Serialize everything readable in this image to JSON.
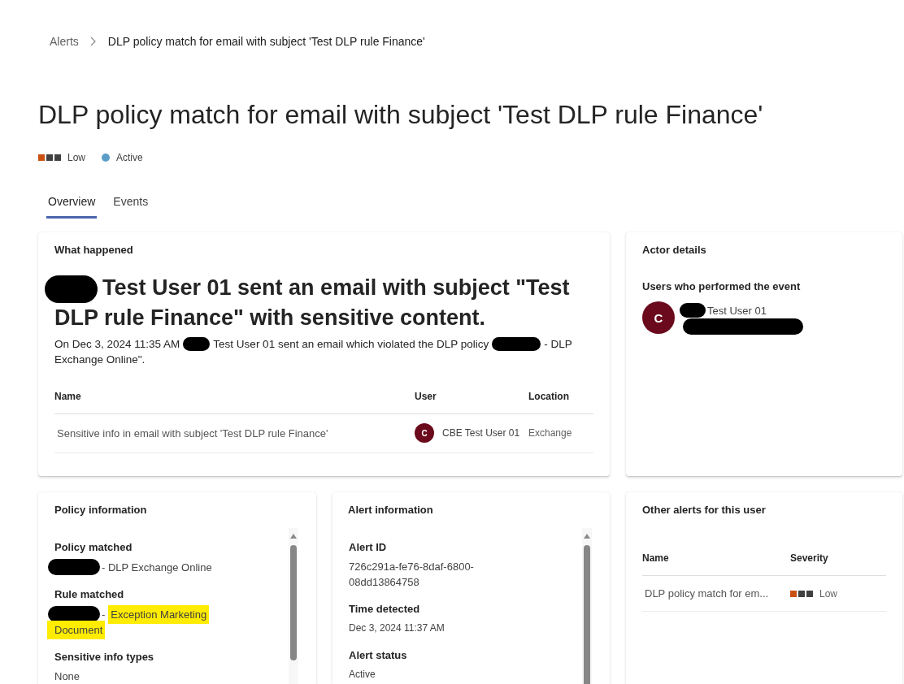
{
  "breadcrumb": [
    {
      "label": "Alerts",
      "current": false
    },
    {
      "label": "DLP policy match for email with subject 'Test DLP rule Finance'",
      "current": true
    }
  ],
  "title": "DLP policy match for email with subject 'Test DLP rule Finance'",
  "severity": {
    "label": "Low",
    "level": 0.33
  },
  "status": {
    "label": "Active",
    "color": "#5b9dc6"
  },
  "tabs": [
    {
      "label": "Overview",
      "selected": true
    },
    {
      "label": "Events",
      "selected": false
    }
  ],
  "what_happened": {
    "heading": "What happened",
    "summary_lines": [
      [
        {
          "kind": "redaction"
        },
        {
          "kind": "text",
          "text": "Test User 01 sent an email with subject \"Test"
        }
      ],
      [
        {
          "kind": "text",
          "text": "DLP rule Finance\" with sensitive content."
        }
      ]
    ],
    "description_lines": [
      [
        {
          "kind": "text",
          "text": "On Dec 3, 2024 11:35 AM"
        },
        {
          "kind": "redaction"
        },
        {
          "kind": "text",
          "text": "Test User 01 sent an email which violated the DLP policy"
        },
        {
          "kind": "redaction"
        },
        {
          "kind": "text",
          "text": "- DLP"
        }
      ],
      [
        {
          "kind": "text",
          "text": "Exchange Online\"."
        }
      ]
    ],
    "table": {
      "columns": [
        "Name",
        "User",
        "Location"
      ],
      "rows": [
        {
          "name": "Sensitive info in email with subject 'Test DLP rule Finance'",
          "user": {
            "initial": "C",
            "name": "CBE Test User 01"
          },
          "location": "Exchange"
        }
      ]
    }
  },
  "actor_details": {
    "heading": "Actor details",
    "subheading": "Users who performed the event",
    "users": [
      {
        "initial": "C",
        "lines": [
          [
            {
              "kind": "redaction"
            },
            {
              "kind": "text",
              "text": "Test User 01"
            }
          ],
          [
            {
              "kind": "redaction"
            }
          ]
        ]
      }
    ]
  },
  "policy_information": {
    "heading": "Policy information",
    "fields": [
      {
        "label": "Policy matched",
        "value_lines": [
          [
            {
              "kind": "redaction"
            },
            {
              "kind": "text",
              "text": "- DLP Exchange Online"
            }
          ]
        ]
      },
      {
        "label": "Rule matched",
        "value_lines": [
          [
            {
              "kind": "redaction"
            },
            {
              "kind": "text",
              "text": "-"
            },
            {
              "kind": "highlight",
              "text": "Exception Marketing"
            }
          ],
          [
            {
              "kind": "highlight",
              "text": "Document"
            }
          ]
        ]
      },
      {
        "label": "Sensitive info types",
        "value_lines": [
          [
            {
              "kind": "text",
              "text": "None"
            }
          ]
        ]
      }
    ]
  },
  "alert_information": {
    "heading": "Alert information",
    "fields": [
      {
        "label": "Alert ID",
        "kind": "id",
        "value": "726c291a-fe76-8daf-6800-08dd13864758"
      },
      {
        "label": "Time detected",
        "kind": "time",
        "value": "Dec 3, 2024 11:37 AM"
      },
      {
        "label": "Alert status",
        "kind": "status",
        "value": "Active"
      }
    ]
  },
  "other_alerts": {
    "heading": "Other alerts for this user",
    "columns": [
      "Name",
      "Severity"
    ],
    "rows": [
      {
        "name": "DLP policy match for em...",
        "severity": {
          "label": "Low",
          "level": 0.33
        }
      }
    ]
  }
}
